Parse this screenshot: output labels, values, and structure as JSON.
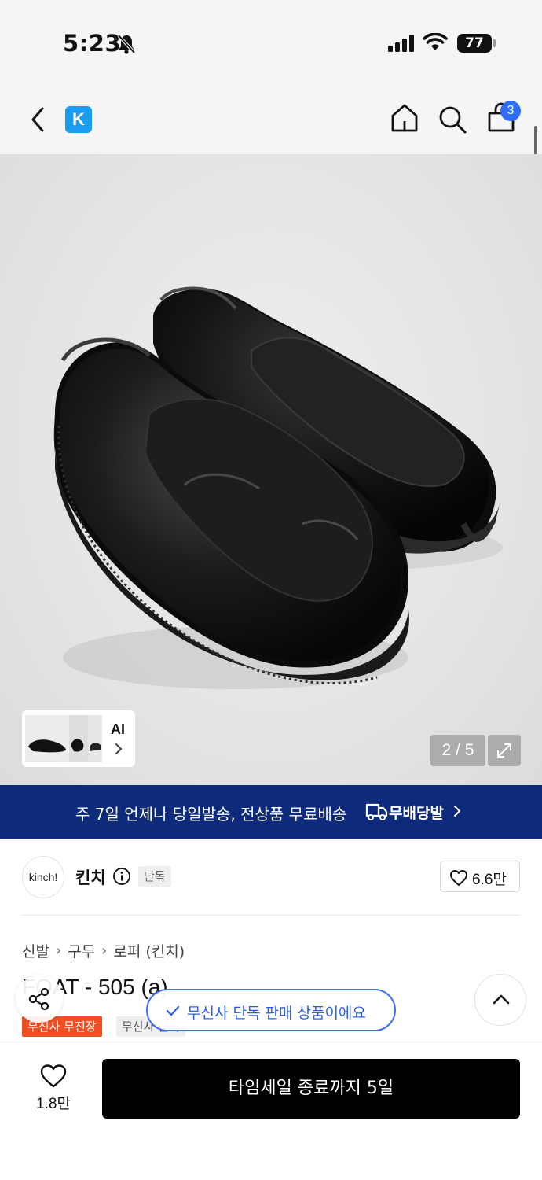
{
  "status_bar": {
    "time": "5:23",
    "battery": "77",
    "icons": [
      "bell-slash-icon",
      "signal-icon",
      "wifi-icon",
      "battery-icon"
    ]
  },
  "nav": {
    "brand_badge": "K",
    "cart_count": "3",
    "icons": [
      "back-icon",
      "home-icon",
      "search-icon",
      "cart-icon"
    ]
  },
  "gallery": {
    "thumb_label": "AI",
    "pager": "2 / 5"
  },
  "banner": {
    "text": "주 7일 언제나 당일발송, 전상품 무료배송",
    "badge": "무배당발"
  },
  "brand": {
    "logo_text": "kinch!",
    "name": "킨치",
    "tag": "단독",
    "likes": "6.6만"
  },
  "breadcrumb": [
    "신발",
    "구두",
    "로퍼 (킨치)"
  ],
  "product": {
    "title": "FOAT - 505 (a)",
    "tags": [
      "무신사 무진장",
      "무신사 단독"
    ]
  },
  "toast": {
    "text": "무신사 단독 판매 상품이에요"
  },
  "bottom_bar": {
    "like_count": "1.8만",
    "cta": "타임세일 종료까지 5일"
  },
  "colors": {
    "accent_blue": "#2f6df6",
    "banner_navy": "#0d2b7a",
    "sale_orange": "#f04e23",
    "cta_black": "#000000"
  }
}
